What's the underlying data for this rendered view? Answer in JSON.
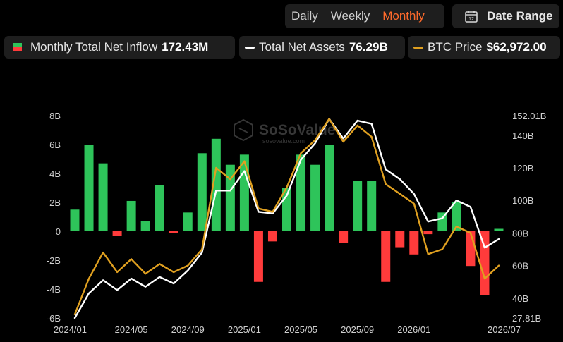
{
  "header": {
    "tabs": [
      {
        "label": "Daily",
        "active": false
      },
      {
        "label": "Weekly",
        "active": false
      },
      {
        "label": "Monthly",
        "active": true
      }
    ],
    "date_range_label": "Date Range",
    "calendar_icon": "calendar-icon",
    "calendar_icon_text": "12"
  },
  "legend": {
    "inflow": {
      "label": "Monthly Total Net Inflow",
      "value": "172.43M"
    },
    "assets": {
      "label": "Total Net Assets",
      "value": "76.29B"
    },
    "price": {
      "label": "BTC Price",
      "value": "$62,972.00"
    }
  },
  "watermark": {
    "name": "SoSoValue",
    "url": "sosovalue.com"
  },
  "colors": {
    "positive": "#2ec45a",
    "negative": "#ff3b3b",
    "assets_line": "#ffffff",
    "price_line": "#e0a020",
    "accent": "#ff6a2b"
  },
  "chart_data": {
    "type": "bar",
    "x": [
      "2024/01",
      "2024/02",
      "2024/03",
      "2024/04",
      "2024/05",
      "2024/06",
      "2024/07",
      "2024/08",
      "2024/09",
      "2024/10",
      "2024/11",
      "2024/12",
      "2025/01",
      "2025/02",
      "2025/03",
      "2025/04",
      "2025/05",
      "2025/06",
      "2025/07",
      "2025/08",
      "2025/09",
      "2025/10",
      "2025/11",
      "2025/12",
      "2026/01",
      "2026/02",
      "2026/03",
      "2026/04",
      "2026/05",
      "2026/06",
      "2026/07"
    ],
    "x_tick_labels": [
      "2024/01",
      "2024/05",
      "2024/09",
      "2025/01",
      "2025/05",
      "2025/09",
      "2026/01",
      "2026/07"
    ],
    "left_axis": {
      "ticks": [
        "8B",
        "6B",
        "4B",
        "2B",
        "0",
        "-2B",
        "-4B",
        "-6B"
      ],
      "range": [
        -6,
        8
      ],
      "unit": "B"
    },
    "right_axis": {
      "ticks": [
        "152.01B",
        "140B",
        "120B",
        "100B",
        "80B",
        "60B",
        "40B",
        "27.81B"
      ],
      "range": [
        27.81,
        152.01
      ],
      "unit": "B"
    },
    "series": [
      {
        "name": "Monthly Total Net Inflow",
        "type": "bar",
        "axis": "left",
        "values": [
          1.5,
          6.0,
          4.7,
          -0.3,
          2.1,
          0.7,
          3.2,
          -0.1,
          1.3,
          5.4,
          6.4,
          4.6,
          5.3,
          -3.5,
          -0.7,
          3.0,
          5.3,
          4.6,
          6.0,
          -0.8,
          3.5,
          3.5,
          -3.5,
          -1.1,
          -1.6,
          -0.2,
          1.3,
          2.0,
          -2.4,
          -4.4,
          0.17
        ]
      },
      {
        "name": "Total Net Assets",
        "type": "line",
        "axis": "right",
        "color": "#ffffff",
        "values": [
          27.81,
          43.0,
          51.0,
          45.0,
          52.0,
          47.0,
          53.0,
          49.0,
          57.0,
          68.0,
          106.0,
          106.0,
          118.0,
          93.0,
          92.0,
          103.0,
          125.0,
          135.0,
          150.0,
          138.0,
          149.0,
          147.0,
          119.0,
          113.0,
          104.0,
          87.0,
          89.0,
          100.0,
          96.0,
          71.0,
          76.29
        ]
      },
      {
        "name": "BTC Price",
        "type": "line",
        "axis": "right",
        "color": "#e0a020",
        "values": [
          30.0,
          52.0,
          68.0,
          56.0,
          64.0,
          55.0,
          61.0,
          56.0,
          60.0,
          70.0,
          120.0,
          113.0,
          124.0,
          95.0,
          93.0,
          108.0,
          129.0,
          137.0,
          150.0,
          136.0,
          146.0,
          139.0,
          110.0,
          104.0,
          98.0,
          67.0,
          70.0,
          84.0,
          80.0,
          52.0,
          60.0
        ]
      }
    ],
    "grid": false,
    "legend_placement": "top"
  }
}
